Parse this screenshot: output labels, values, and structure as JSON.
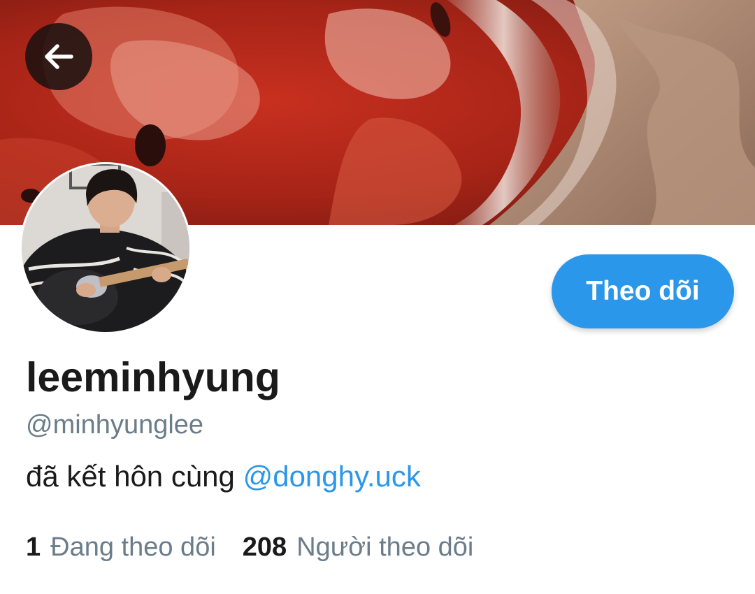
{
  "profile": {
    "display_name": "leeminhyung",
    "handle": "@minhyunglee",
    "bio": {
      "text": "đã kết hôn cùng ",
      "mention": "@donghy.uck"
    },
    "follow_button_label": "Theo dõi",
    "stats": {
      "following_count": "1",
      "following_label": "Đang theo dõi",
      "followers_count": "208",
      "followers_label": "Người theo dõi"
    }
  },
  "icons": {
    "back": "arrow-left-icon"
  },
  "colors": {
    "accent": "#2b97ea",
    "secondary_text": "#6b7c8a",
    "primary_text": "#1a1a1a",
    "banner_red": "#a9241a"
  }
}
